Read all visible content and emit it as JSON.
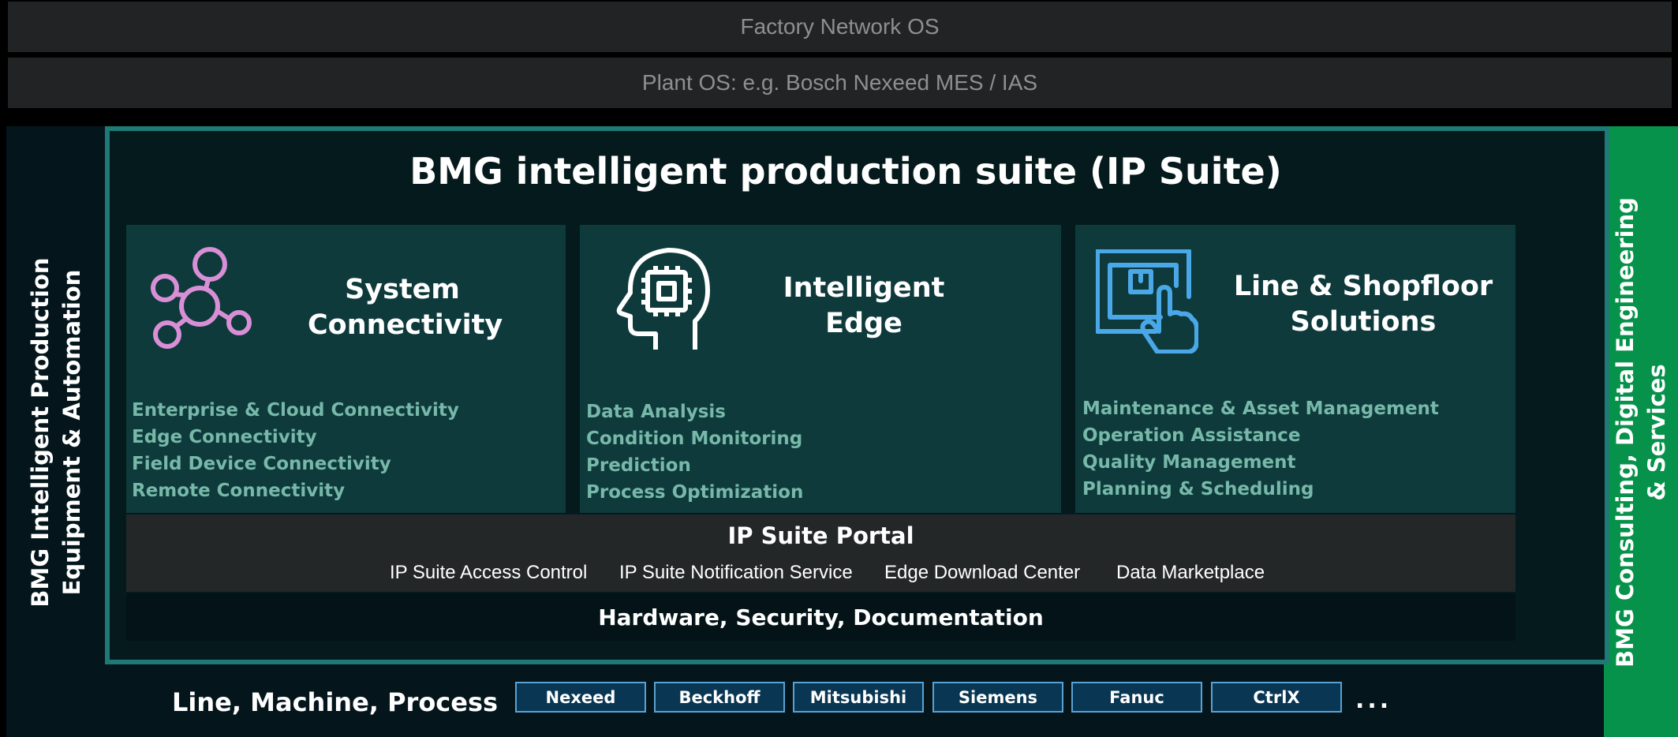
{
  "top_bars": {
    "factory_os": "Factory Network OS",
    "plant_os": "Plant OS: e.g. Bosch Nexeed MES / IAS"
  },
  "left_band": {
    "line1": "BMG Intelligent Production",
    "line2": "Equipment & Automation"
  },
  "right_band": {
    "line1": "BMG Consulting, Digital Engineering",
    "line2": "& Services"
  },
  "suite": {
    "title": "BMG intelligent production suite (IP Suite)"
  },
  "modules": {
    "connectivity": {
      "icon": "network-hub-icon",
      "title_line1": "System",
      "title_line2": "Connectivity",
      "items": [
        "Enterprise & Cloud Connectivity",
        "Edge Connectivity",
        "Field Device Connectivity",
        "Remote Connectivity"
      ]
    },
    "edge": {
      "icon": "head-chip-icon",
      "title_line1": "Intelligent",
      "title_line2": "Edge",
      "items": [
        "Data Analysis",
        "Condition Monitoring",
        "Prediction",
        "Process Optimization"
      ]
    },
    "line": {
      "icon": "touch-screen-icon",
      "title_line1": "Line & Shopfloor",
      "title_line2": "Solutions",
      "items": [
        "Maintenance & Asset Management",
        "Operation Assistance",
        "Quality Management",
        "Planning & Scheduling"
      ]
    }
  },
  "portal": {
    "title": "IP Suite Portal",
    "items": [
      "IP Suite Access Control",
      "IP Suite Notification Service",
      "Edge Download Center",
      "Data Marketplace"
    ]
  },
  "hardware": {
    "label": "Hardware, Security, Documentation"
  },
  "line_machine": {
    "label": "Line, Machine, Process",
    "vendors": [
      "Nexeed",
      "Beckhoff",
      "Mitsubishi",
      "Siemens",
      "Fanuc",
      "CtrlX"
    ],
    "more": "..."
  },
  "colors": {
    "teal_frame": "#1f7a75",
    "module_bg": "#0e3a3c",
    "green_band": "#06924a",
    "list_text": "#77b8a9",
    "connectivity_icon": "#d98fd6",
    "line_icon": "#4aa8e8",
    "vendor_border": "#5aa2d4"
  }
}
